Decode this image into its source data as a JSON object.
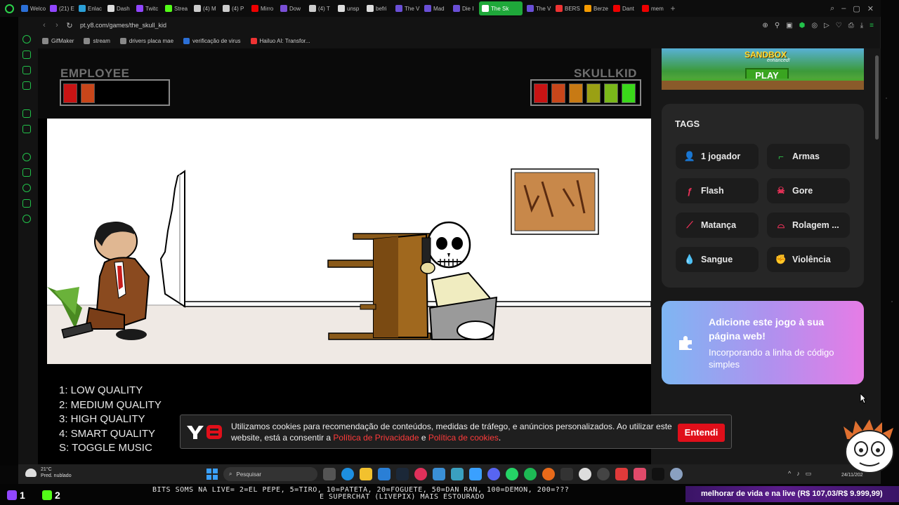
{
  "browser": {
    "tabs": [
      {
        "label": "Welco",
        "color": "#2b6fd6"
      },
      {
        "label": "(21) E",
        "color": "#9146ff"
      },
      {
        "label": "Enlac",
        "color": "#2b9fd6"
      },
      {
        "label": "Dash",
        "color": "#ddd"
      },
      {
        "label": "Twitc",
        "color": "#9146ff"
      },
      {
        "label": "Strea",
        "color": "#53fc18"
      },
      {
        "label": "(4) M",
        "color": "#ccc"
      },
      {
        "label": "(4) P",
        "color": "#ccc"
      },
      {
        "label": "Mirro",
        "color": "#e00"
      },
      {
        "label": "Dow",
        "color": "#7a4fd6"
      },
      {
        "label": "(4) T",
        "color": "#ccc"
      },
      {
        "label": "unsp",
        "color": "#ddd"
      },
      {
        "label": "befri",
        "color": "#ddd"
      },
      {
        "label": "The V",
        "color": "#6a4fd6"
      },
      {
        "label": "Mad",
        "color": "#6a4fd6"
      },
      {
        "label": "Die I",
        "color": "#6a4fd6"
      },
      {
        "label": "The Sk",
        "color": "#fff",
        "active": true
      },
      {
        "label": "The V",
        "color": "#6a4fd6"
      },
      {
        "label": "BERS",
        "color": "#e33"
      },
      {
        "label": "Berze",
        "color": "#f59b00"
      },
      {
        "label": "Dant",
        "color": "#e00"
      },
      {
        "label": "mem",
        "color": "#e00"
      }
    ],
    "url": "pt.y8.com/games/the_skull_kid",
    "bookmarks": [
      {
        "label": "GifMaker",
        "color": "#888"
      },
      {
        "label": "stream",
        "color": "#888"
      },
      {
        "label": "drivers placa mae",
        "color": "#888"
      },
      {
        "label": "verificação de virus",
        "color": "#2b6fd6"
      },
      {
        "label": "Hailuo AI: Transfor...",
        "color": "#e33"
      }
    ]
  },
  "game": {
    "employee_label": "EMPLOYEE",
    "skullkid_label": "SKULLKID",
    "employee_health": 0.4,
    "skullkid_health": 1.0,
    "menu": [
      "1: LOW QUALITY",
      "2: MEDIUM QUALITY",
      "3: HIGH QUALITY",
      "4: SMART QUALITY",
      "S: TOGGLE MUSIC"
    ]
  },
  "ad": {
    "title": "SANDBOX",
    "subtitle": "enhanced!",
    "play_label": "PLAY"
  },
  "tags": {
    "title": "TAGS",
    "items": [
      {
        "label": "1 jogador",
        "icon": "user-icon",
        "color": "#4aa8f0"
      },
      {
        "label": "Armas",
        "icon": "gun-icon",
        "color": "#2fc24a"
      },
      {
        "label": "Flash",
        "icon": "flash-icon",
        "color": "#f0325a"
      },
      {
        "label": "Gore",
        "icon": "skull-icon",
        "color": "#f0325a"
      },
      {
        "label": "Matança",
        "icon": "knife-icon",
        "color": "#f0325a"
      },
      {
        "label": "Rolagem ...",
        "icon": "scroll-icon",
        "color": "#f0325a"
      },
      {
        "label": "Sangue",
        "icon": "blood-drop-icon",
        "color": "#f0325a"
      },
      {
        "label": "Violência",
        "icon": "fist-icon",
        "color": "#f08a3a"
      }
    ]
  },
  "embed": {
    "title": "Adicione este jogo à sua página web!",
    "subtitle": "Incorporando a linha de código simples"
  },
  "cookie": {
    "text_before": "Utilizamos cookies para recomendação de conteúdos, medidas de tráfego, e anúncios personalizados. Ao utilizar este website, está a consentir a ",
    "privacy_link": "Política de Privacidade",
    "and": " e ",
    "cookies_link": "Política de cookies",
    "end": ".",
    "button": "Entendi"
  },
  "taskbar": {
    "temp": "21°C",
    "weather": "Pred. nublado",
    "search": "Pesquisar",
    "clock": "24/11/202"
  },
  "stream": {
    "rank1": "1",
    "rank2": "2",
    "ticker_line1": "BITS SOMS NA LIVE= 2=EL PEPE, 5=TIRO, 10=PATETA, 20=FOGUETE, 50=DAN RAN, 100=DEMON, 200=???",
    "ticker_line2": "E SUPERCHAT (LIVEPIX) MAIS ESTOURADO",
    "goal": "melhorar de vida e na live (R$ 107,03/R$ 9.999,99)"
  }
}
